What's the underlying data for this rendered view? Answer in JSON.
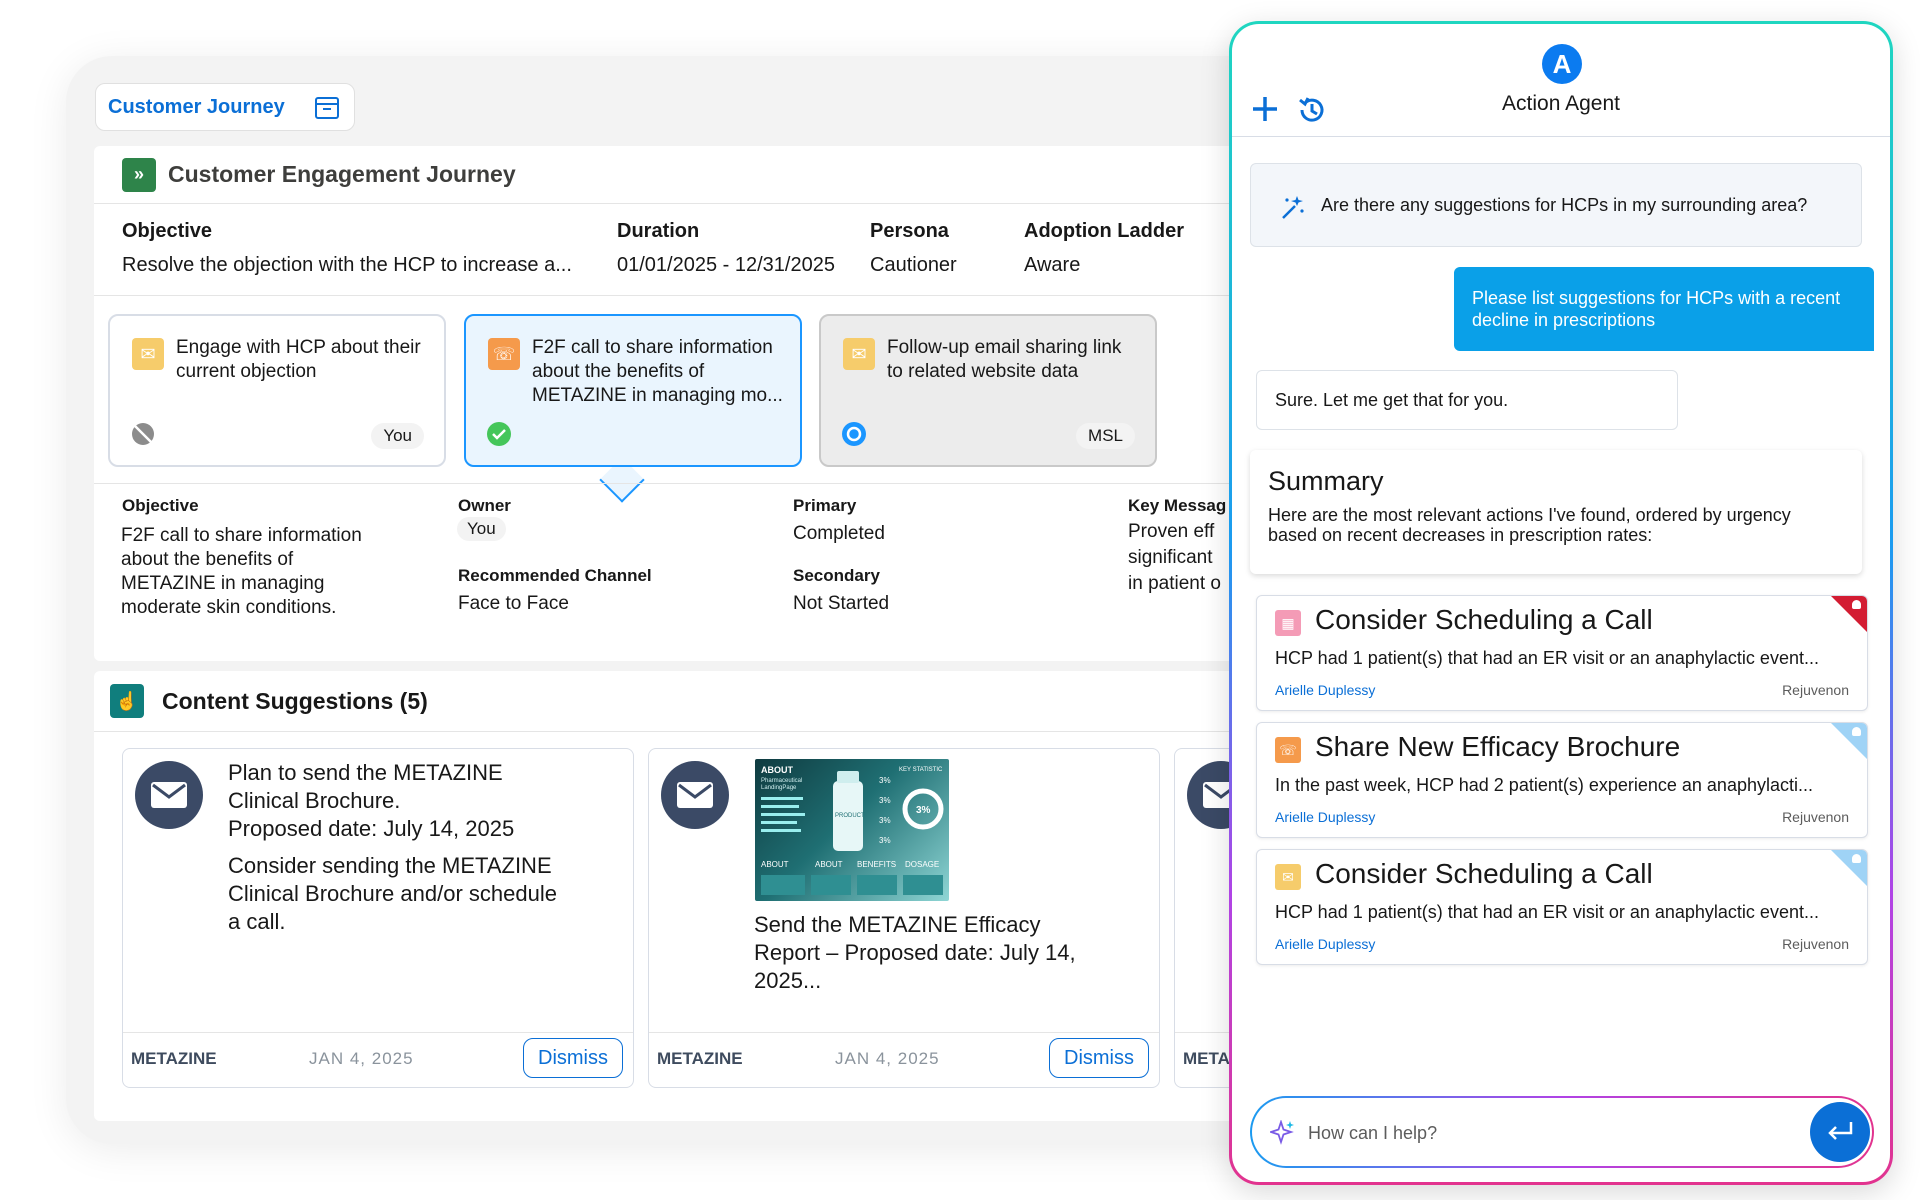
{
  "app": {
    "tab_label": "Customer Journey"
  },
  "journey": {
    "title": "Customer Engagement Journey",
    "objective_label": "Objective",
    "objective_value": "Resolve the objection with the HCP to increase a...",
    "duration_label": "Duration",
    "duration_value": "01/01/2025 - 12/31/2025",
    "persona_label": "Persona",
    "persona_value": "Cautioner",
    "ladder_label": "Adoption Ladder",
    "ladder_value": "Aware",
    "steps": [
      {
        "text": "Engage with HCP about their current objection",
        "owner": "You",
        "status": "blocked",
        "color": "#f6cc6b"
      },
      {
        "text": "F2F call to share information about the benefits of METAZINE in managing mo...",
        "owner": "",
        "status": "completed",
        "color": "#f59a4b"
      },
      {
        "text": "Follow-up email sharing link to related website data",
        "owner": "MSL",
        "status": "in-progress",
        "color": "#f6cc6b"
      }
    ],
    "detail": {
      "objective_label": "Objective",
      "objective_value": "F2F call to share information about the benefits of METAZINE in managing moderate skin conditions.",
      "owner_label": "Owner",
      "owner_value": "You",
      "channel_label": "Recommended Channel",
      "channel_value": "Face to Face",
      "primary_label": "Primary",
      "primary_value": "Completed",
      "secondary_label": "Secondary",
      "secondary_value": "Not Started",
      "key_label": "Key Messag",
      "key_lines": [
        "Proven eff",
        "significant",
        "in patient o"
      ]
    }
  },
  "content": {
    "title": "Content Suggestions (5)",
    "cards": [
      {
        "text_lines": [
          "Plan to send the METAZINE",
          "Clinical Brochure.",
          "Proposed date: July 14, 2025"
        ],
        "text_lines_2": [
          "Consider sending the METAZINE",
          "Clinical Brochure and/or schedule",
          "a call."
        ],
        "brand": "METAZINE",
        "date": "JAN 4, 2025",
        "dismiss": "Dismiss"
      },
      {
        "text_lines": [
          "Send the METAZINE Efficacy",
          "Report – Proposed date: July 14,",
          "2025..."
        ],
        "brand": "METAZINE",
        "date": "JAN 4, 2025",
        "dismiss": "Dismiss",
        "thumb_labels": [
          "ABOUT",
          "Pharmaceutical",
          "LandingPage",
          "KEY STATISTIC",
          "PRODUCT",
          "ABOUT",
          "ABOUT",
          "BENEFITS",
          "DOSAGE",
          "3%",
          "3%",
          "3%",
          "3%",
          "3%"
        ]
      },
      {
        "brand": "META"
      }
    ]
  },
  "agent": {
    "logo": "A",
    "title": "Action Agent",
    "prompt": "Are there any suggestions for HCPs in my surrounding area?",
    "user_message": "Please list suggestions for HCPs with a recent decline in prescriptions",
    "bot_message": "Sure. Let me get that for you.",
    "summary_title": "Summary",
    "summary_text": "Here are the most relevant actions I've found, ordered by urgency based on recent decreases in prescription rates:",
    "recommendations": [
      {
        "icon": "calendar-icon",
        "icon_color": "#f49bb6",
        "flag_color": "#d31c32",
        "title": "Consider Scheduling a Call",
        "body": "HCP had 1 patient(s) that had an ER visit or an anaphylactic event...",
        "owner": "Arielle Duplessy",
        "product": "Rejuvenon"
      },
      {
        "icon": "call-icon",
        "icon_color": "#f59a4b",
        "flag_color": "#9fd3f6",
        "title": "Share New Efficacy Brochure",
        "body": "In the past week, HCP had 2 patient(s) experience an anaphylacti...",
        "owner": "Arielle Duplessy",
        "product": "Rejuvenon"
      },
      {
        "icon": "email-icon",
        "icon_color": "#f6cc6b",
        "flag_color": "#9fd3f6",
        "title": "Consider Scheduling a Call",
        "body": "HCP had 1 patient(s) that had an ER visit or an anaphylactic event...",
        "owner": "Arielle Duplessy",
        "product": "Rejuvenon"
      }
    ],
    "input_placeholder": "How can I help?"
  }
}
